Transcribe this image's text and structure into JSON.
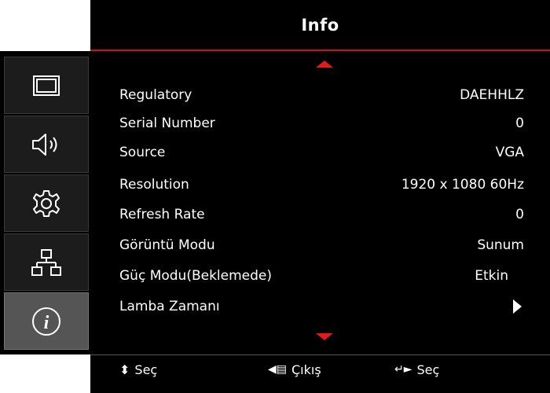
{
  "header": {
    "title": "Info"
  },
  "sidebar": {
    "tabs": [
      {
        "icon": "display-icon",
        "active": false
      },
      {
        "icon": "audio-icon",
        "active": false
      },
      {
        "icon": "settings-icon",
        "active": false
      },
      {
        "icon": "network-icon",
        "active": false
      },
      {
        "icon": "info-icon",
        "active": true
      }
    ]
  },
  "rows": [
    {
      "label": "Regulatory",
      "value": "DAEHHLZ"
    },
    {
      "label": "Serial Number",
      "value": "0"
    },
    {
      "label": "Source",
      "value": "VGA"
    },
    {
      "label": "Resolution",
      "value": "1920 x 1080 60Hz"
    },
    {
      "label": "Refresh Rate",
      "value": "0"
    },
    {
      "label": "Görüntü Modu",
      "value": "Sunum"
    },
    {
      "label": "Güç Modu(Beklemede)",
      "value": "Etkin"
    },
    {
      "label": "Lamba Zamanı",
      "value": ""
    }
  ],
  "footer": {
    "select_label": "Seç",
    "exit_label": "Çıkış",
    "enter_label": "Seç"
  },
  "colors": {
    "accent": "#c8102e",
    "arrow": "#e21a1a",
    "background": "#000000",
    "active_tab": "#555555"
  }
}
